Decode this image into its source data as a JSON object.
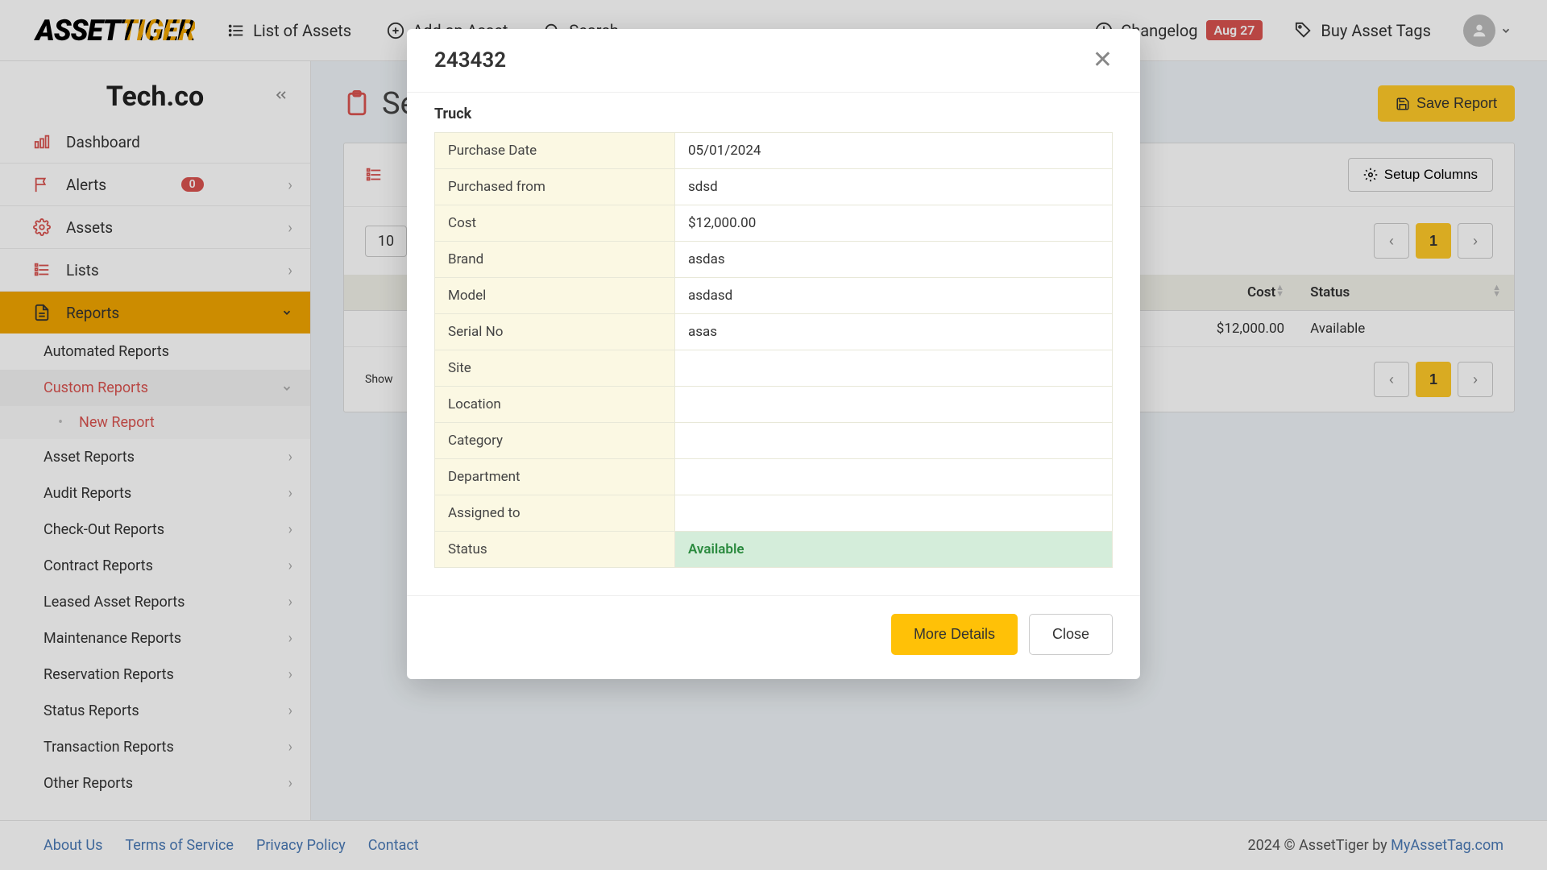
{
  "topbar": {
    "logo_a": "ASSET",
    "logo_b": "TIGER",
    "links": {
      "list": "List of Assets",
      "add": "Add an Asset",
      "search": "Search",
      "changelog": "Changelog",
      "changelog_date": "Aug 27",
      "buy_tags": "Buy Asset Tags"
    }
  },
  "sidebar": {
    "company": "Tech.co",
    "items": {
      "dashboard": "Dashboard",
      "alerts": "Alerts",
      "alerts_count": "0",
      "assets": "Assets",
      "lists": "Lists",
      "reports": "Reports"
    },
    "reports_sub": {
      "automated": "Automated Reports",
      "custom": "Custom Reports",
      "new_report": "New Report",
      "asset": "Asset Reports",
      "audit": "Audit Reports",
      "checkout": "Check-Out Reports",
      "contract": "Contract Reports",
      "leased": "Leased Asset Reports",
      "maintenance": "Maintenance Reports",
      "reservation": "Reservation Reports",
      "status": "Status Reports",
      "transaction": "Transaction Reports",
      "other": "Other Reports"
    }
  },
  "page": {
    "title_partial": "Se",
    "save_report": "Save Report",
    "setup_columns": "Setup Columns",
    "page_size": "10",
    "current_page": "1",
    "showing_partial": "Show",
    "table": {
      "headers": {
        "cost": "Cost",
        "status": "Status"
      },
      "row": {
        "cost": "$12,000.00",
        "status": "Available"
      }
    }
  },
  "footer": {
    "about": "About Us",
    "terms": "Terms of Service",
    "privacy": "Privacy Policy",
    "contact": "Contact",
    "copyright_a": "2024 © AssetTiger by ",
    "copyright_b": "MyAssetTag.com"
  },
  "modal": {
    "title": "243432",
    "subtitle": "Truck",
    "rows": [
      {
        "label": "Purchase Date",
        "value": "05/01/2024"
      },
      {
        "label": "Purchased from",
        "value": "sdsd"
      },
      {
        "label": "Cost",
        "value": "$12,000.00"
      },
      {
        "label": "Brand",
        "value": "asdas"
      },
      {
        "label": "Model",
        "value": "asdasd"
      },
      {
        "label": "Serial No",
        "value": "asas"
      },
      {
        "label": "Site",
        "value": ""
      },
      {
        "label": "Location",
        "value": ""
      },
      {
        "label": "Category",
        "value": ""
      },
      {
        "label": "Department",
        "value": ""
      },
      {
        "label": "Assigned to",
        "value": ""
      },
      {
        "label": "Status",
        "value": "Available",
        "status": true
      }
    ],
    "more_details": "More Details",
    "close": "Close"
  }
}
